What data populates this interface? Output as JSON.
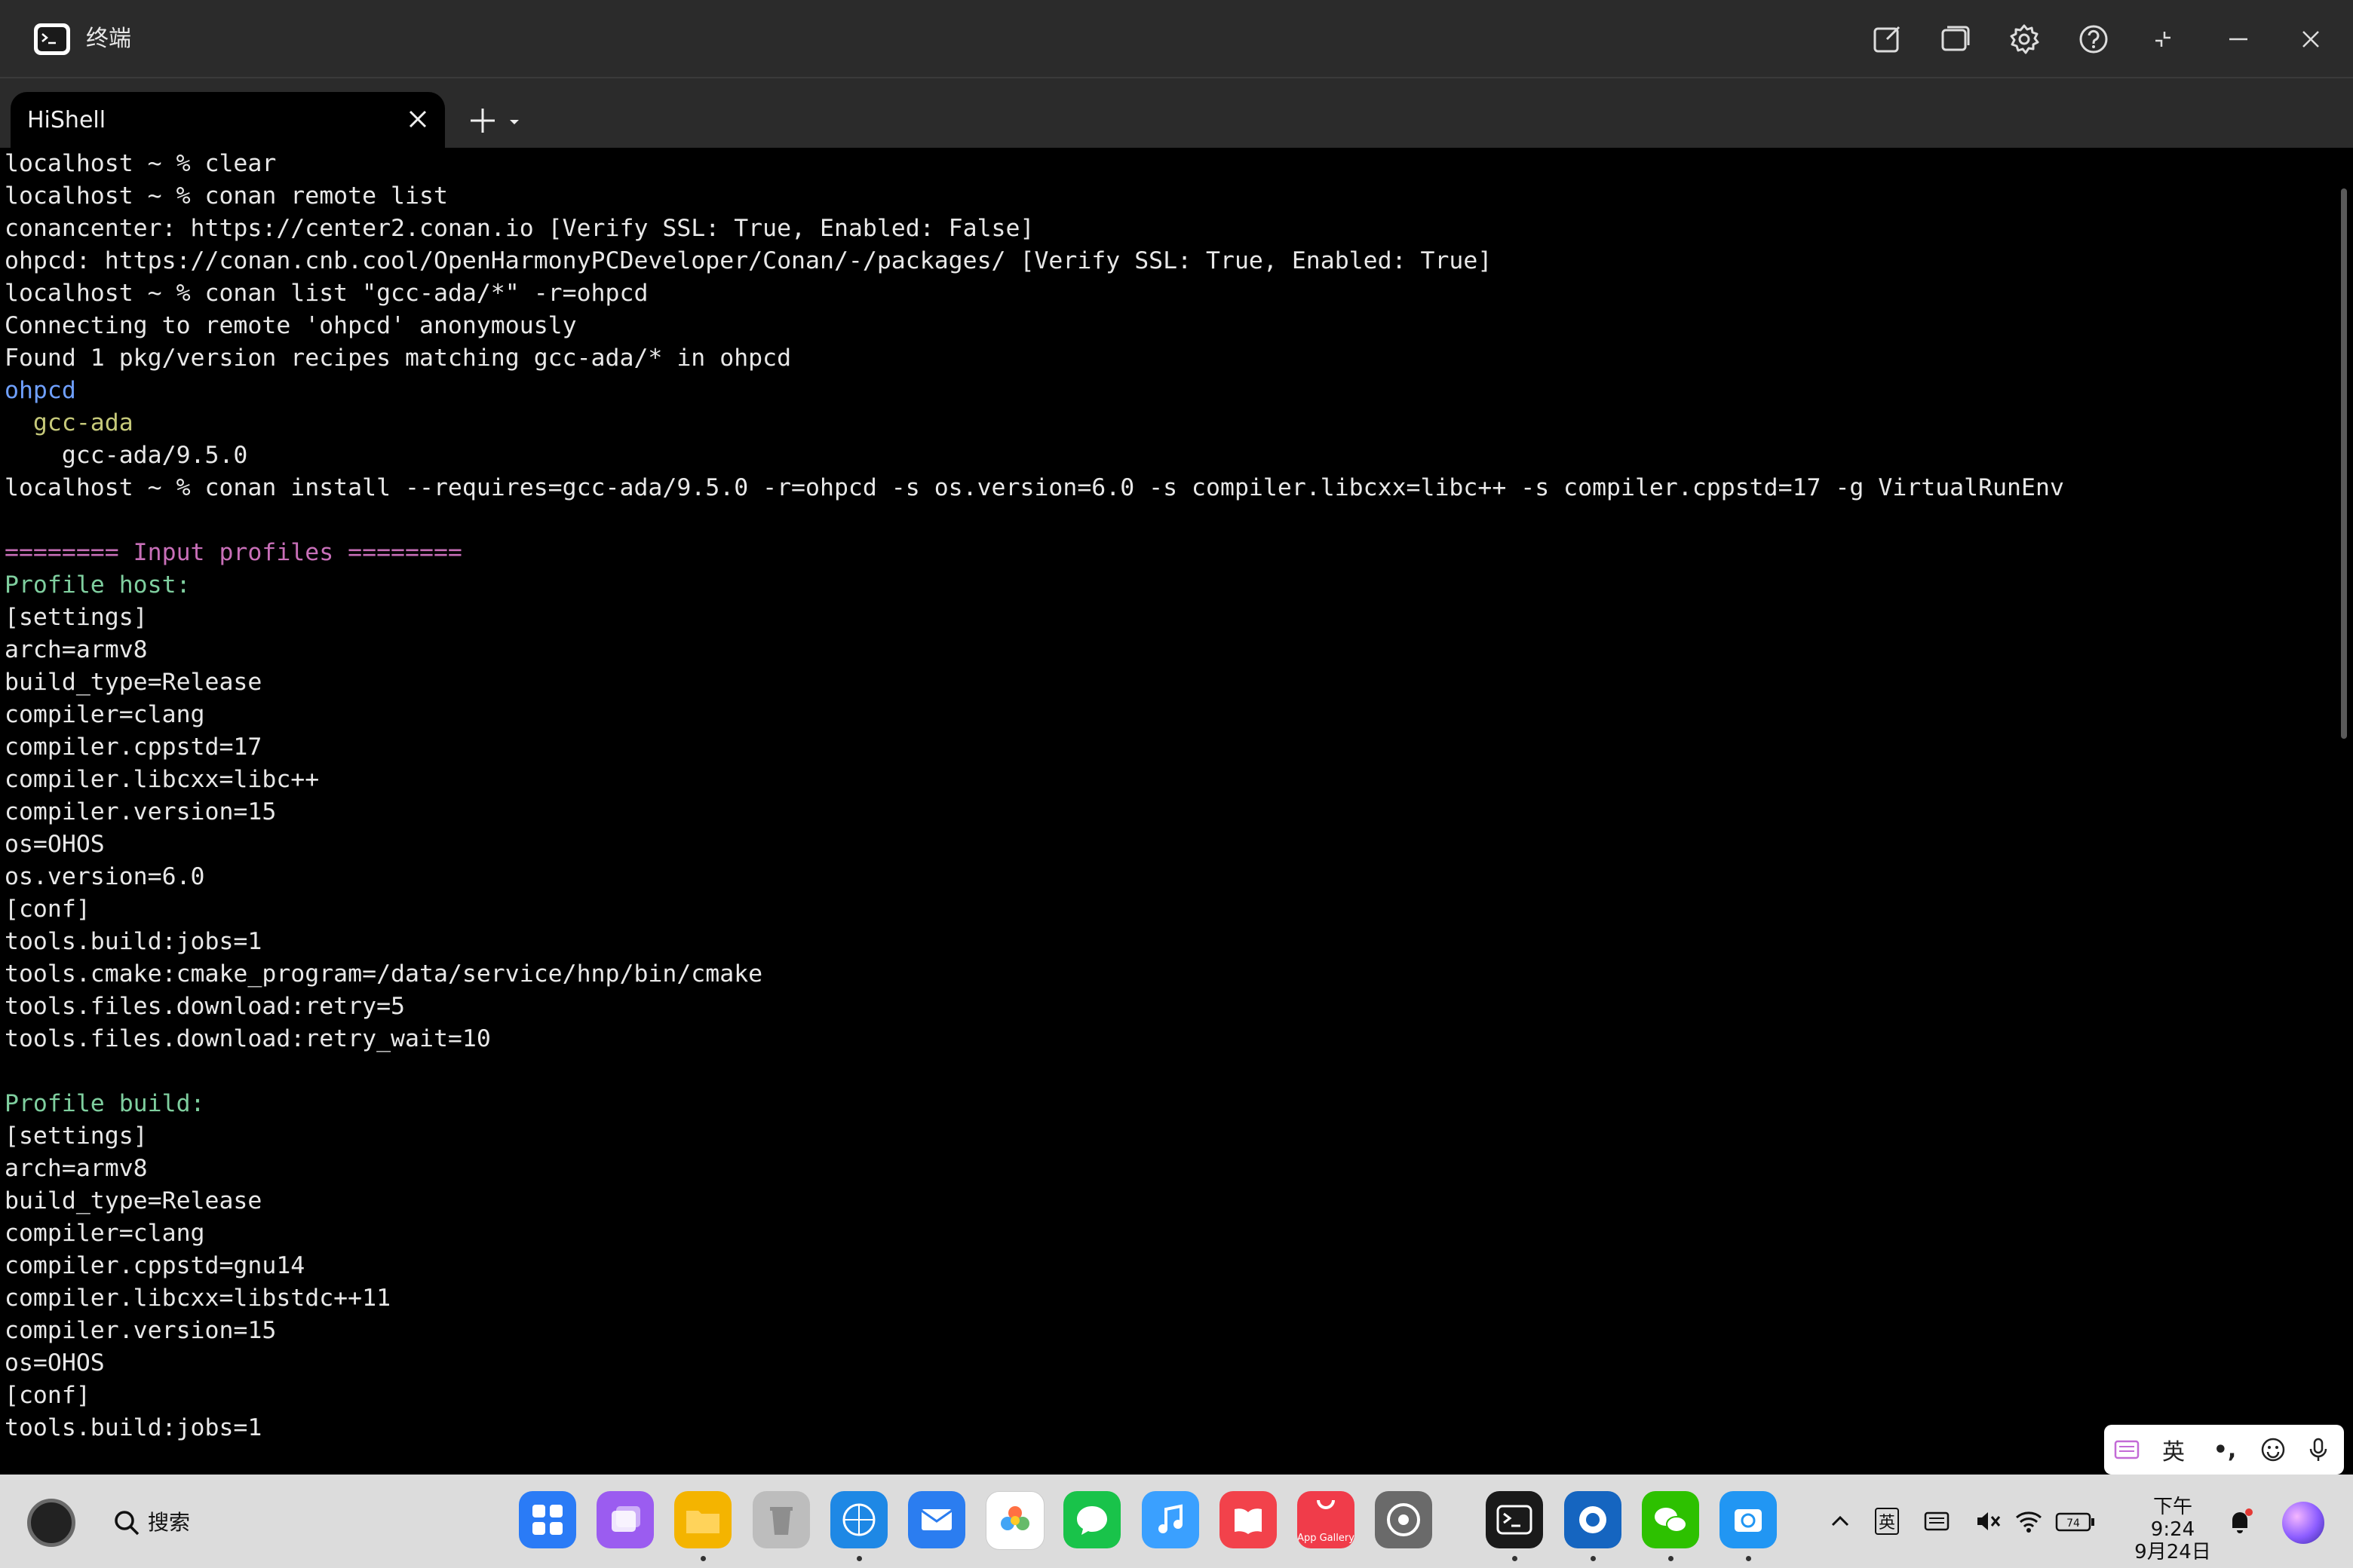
{
  "window": {
    "title": "终端"
  },
  "tabs": [
    {
      "label": "HiShell"
    }
  ],
  "terminal": {
    "lines": [
      {
        "text": "localhost ~ % clear",
        "color": "default"
      },
      {
        "text": "localhost ~ % conan remote list",
        "color": "default"
      },
      {
        "text": "conancenter: https://center2.conan.io [Verify SSL: True, Enabled: False]",
        "color": "default"
      },
      {
        "text": "ohpcd: https://conan.cnb.cool/OpenHarmonyPCDeveloper/Conan/-/packages/ [Verify SSL: True, Enabled: True]",
        "color": "default"
      },
      {
        "text": "localhost ~ % conan list \"gcc-ada/*\" -r=ohpcd",
        "color": "default"
      },
      {
        "text": "Connecting to remote 'ohpcd' anonymously",
        "color": "default"
      },
      {
        "text": "Found 1 pkg/version recipes matching gcc-ada/* in ohpcd",
        "color": "default"
      },
      {
        "text": "ohpcd",
        "color": "blue"
      },
      {
        "text": "  gcc-ada",
        "color": "olive"
      },
      {
        "text": "    gcc-ada/9.5.0",
        "color": "default"
      },
      {
        "text": "localhost ~ % conan install --requires=gcc-ada/9.5.0 -r=ohpcd -s os.version=6.0 -s compiler.libcxx=libc++ -s compiler.cppstd=17 -g VirtualRunEnv",
        "color": "default"
      },
      {
        "text": "",
        "color": "default"
      },
      {
        "text": "======== Input profiles ========",
        "color": "pink"
      },
      {
        "text": "Profile host:",
        "color": "green"
      },
      {
        "text": "[settings]",
        "color": "default"
      },
      {
        "text": "arch=armv8",
        "color": "default"
      },
      {
        "text": "build_type=Release",
        "color": "default"
      },
      {
        "text": "compiler=clang",
        "color": "default"
      },
      {
        "text": "compiler.cppstd=17",
        "color": "default"
      },
      {
        "text": "compiler.libcxx=libc++",
        "color": "default"
      },
      {
        "text": "compiler.version=15",
        "color": "default"
      },
      {
        "text": "os=OHOS",
        "color": "default"
      },
      {
        "text": "os.version=6.0",
        "color": "default"
      },
      {
        "text": "[conf]",
        "color": "default"
      },
      {
        "text": "tools.build:jobs=1",
        "color": "default"
      },
      {
        "text": "tools.cmake:cmake_program=/data/service/hnp/bin/cmake",
        "color": "default"
      },
      {
        "text": "tools.files.download:retry=5",
        "color": "default"
      },
      {
        "text": "tools.files.download:retry_wait=10",
        "color": "default"
      },
      {
        "text": "",
        "color": "default"
      },
      {
        "text": "Profile build:",
        "color": "green"
      },
      {
        "text": "[settings]",
        "color": "default"
      },
      {
        "text": "arch=armv8",
        "color": "default"
      },
      {
        "text": "build_type=Release",
        "color": "default"
      },
      {
        "text": "compiler=clang",
        "color": "default"
      },
      {
        "text": "compiler.cppstd=gnu14",
        "color": "default"
      },
      {
        "text": "compiler.libcxx=libstdc++11",
        "color": "default"
      },
      {
        "text": "compiler.version=15",
        "color": "default"
      },
      {
        "text": "os=OHOS",
        "color": "default"
      },
      {
        "text": "[conf]",
        "color": "default"
      },
      {
        "text": "tools.build:jobs=1",
        "color": "default"
      }
    ]
  },
  "ime": {
    "lang": "英",
    "punct": "•,",
    "icons": [
      "handwriting-keyboard-icon",
      "emoji-icon",
      "microphone-icon"
    ]
  },
  "taskbar": {
    "search_label": "搜索",
    "apps": [
      {
        "name": "app-launcher",
        "color": "#2a7bf6",
        "active": false
      },
      {
        "name": "multitask",
        "color": "#9b5cf0",
        "active": false
      },
      {
        "name": "files",
        "color": "#f4b400",
        "active": true
      },
      {
        "name": "recycle-bin",
        "color": "#bdbdbd",
        "active": false
      },
      {
        "name": "browser",
        "color": "#1e88e5",
        "active": true
      },
      {
        "name": "email",
        "color": "#2b7df0",
        "active": false
      },
      {
        "name": "gallery",
        "color": "#ffffff",
        "active": false
      },
      {
        "name": "messages",
        "color": "#19c34a",
        "active": false
      },
      {
        "name": "music",
        "color": "#3aa0ff",
        "active": false
      },
      {
        "name": "books",
        "color": "#f2424b",
        "active": false
      },
      {
        "name": "app-gallery",
        "color": "#f03c4a",
        "active": false,
        "label": "App Gallery"
      },
      {
        "name": "settings",
        "color": "#6a6a6a",
        "active": false
      },
      {
        "name": "terminal",
        "color": "#1a1a1a",
        "active": true
      },
      {
        "name": "meeting",
        "color": "#1565c0",
        "active": true
      },
      {
        "name": "wechat",
        "color": "#2dc100",
        "active": true
      },
      {
        "name": "app-store",
        "color": "#2196f3",
        "active": true
      }
    ],
    "tray": {
      "ime_lang": "英",
      "battery": "74"
    },
    "clock": {
      "time": "下午9:24",
      "date": "9月24日"
    }
  },
  "colors": {
    "terminal_bg": "#000000",
    "titlebar_bg": "#2b2b2b",
    "taskbar_bg": "#dcdcdc"
  }
}
